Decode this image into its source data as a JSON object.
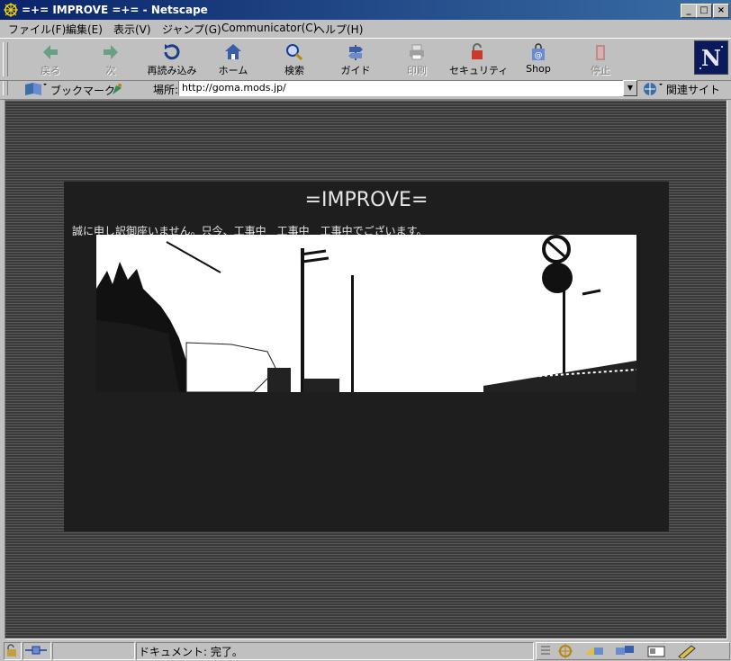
{
  "window": {
    "title": "=+= IMPROVE =+= - Netscape"
  },
  "menu": [
    "ファイル(F)",
    "編集(E)",
    "表示(V)",
    "ジャンプ(G)",
    "Communicator(C)",
    "ヘルプ(H)"
  ],
  "toolbar": {
    "back": "戻る",
    "forward": "次",
    "reload": "再読み込み",
    "home": "ホーム",
    "search": "検索",
    "guide": "ガイド",
    "print": "印刷",
    "security": "セキュリティ",
    "shop": "Shop",
    "stop": "停止"
  },
  "location": {
    "bookmarks_label": "ブックマーク",
    "label": "場所:",
    "url": "http://goma.mods.jp/",
    "related_label": "関連サイト"
  },
  "page": {
    "title": "=IMPROVE=",
    "notice": "誠に申し訳御座いません。只今、工事中　工事中　工事中でございます。"
  },
  "status": {
    "text": "ドキュメント: 完了。"
  },
  "colors": {
    "titlebar_start": "#0a246a",
    "titlebar_end": "#3a6ea5",
    "panel_bg": "#1e1e1e"
  }
}
